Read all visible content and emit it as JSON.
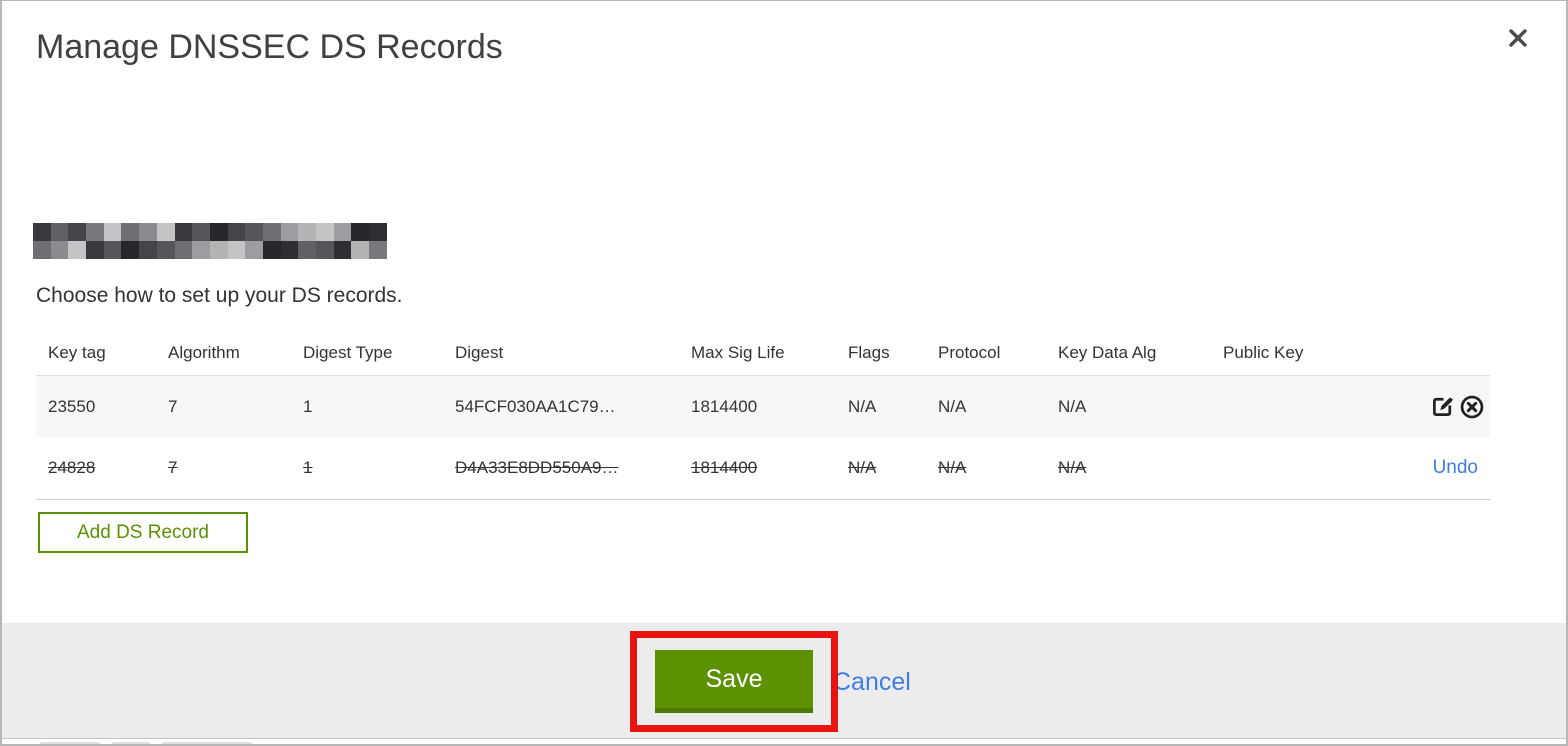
{
  "modal": {
    "title": "Manage DNSSEC DS Records",
    "close": "close",
    "domain_redacted": true,
    "subtitle": "Choose how to set up your DS records."
  },
  "table": {
    "headers": [
      "Key tag",
      "Algorithm",
      "Digest Type",
      "Digest",
      "Max Sig Life",
      "Flags",
      "Protocol",
      "Key Data Alg",
      "Public Key"
    ],
    "rows": [
      {
        "key_tag": "23550",
        "algorithm": "7",
        "digest_type": "1",
        "digest": "54FCF030AA1C79…",
        "max_sig_life": "1814400",
        "flags": "N/A",
        "protocol": "N/A",
        "key_data_alg": "N/A",
        "public_key": "",
        "state": "normal",
        "actions": [
          "edit",
          "delete"
        ]
      },
      {
        "key_tag": "24828",
        "algorithm": "7",
        "digest_type": "1",
        "digest": "D4A33E8DD550A9…",
        "max_sig_life": "1814400",
        "flags": "N/A",
        "protocol": "N/A",
        "key_data_alg": "N/A",
        "public_key": "",
        "state": "marked-for-deletion",
        "undo_label": "Undo"
      }
    ]
  },
  "buttons": {
    "add_ds_record": "Add DS Record",
    "save": "Save",
    "cancel": "Cancel"
  },
  "colors": {
    "action_green": "#5c9104",
    "action_green_dark": "#4c7a03",
    "outline_green": "#5a9100",
    "link_blue": "#3d7de4",
    "annotation_red": "#e8140f",
    "row_alt_bg": "#f7f7f7",
    "footer_bg": "#ececec"
  }
}
